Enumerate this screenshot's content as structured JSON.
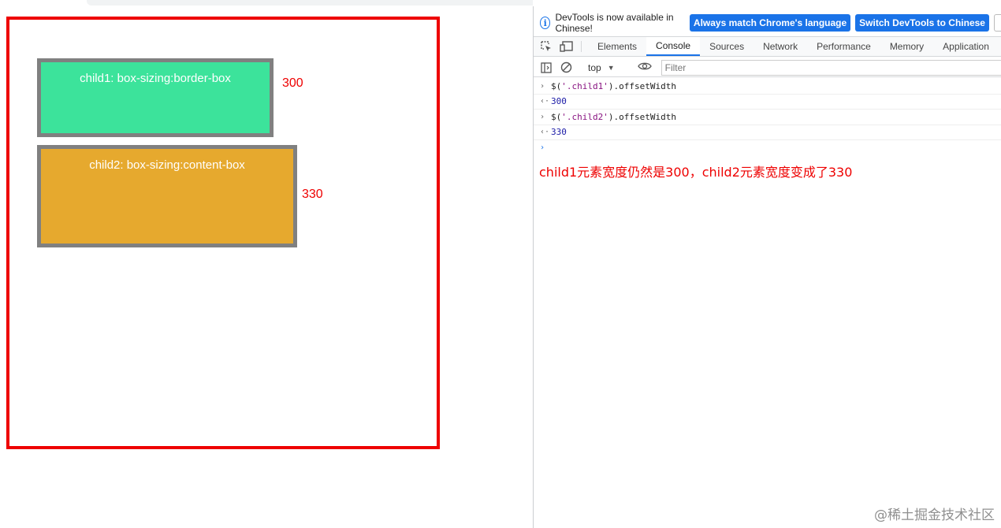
{
  "page": {
    "child1_label": "child1: box-sizing:border-box",
    "child2_label": "child2: box-sizing:content-box",
    "annotation_child1": "300",
    "annotation_child2": "330",
    "colors": {
      "parent_border": "#ee0000",
      "child1_bg": "#3ce39b",
      "child2_bg": "#e6a92e",
      "child_border": "#808080"
    }
  },
  "devtools": {
    "infobar": {
      "message": "DevTools is now available in Chinese!",
      "match_button": "Always match Chrome's language",
      "switch_button": "Switch DevTools to Chinese"
    },
    "tabs": [
      "Elements",
      "Console",
      "Sources",
      "Network",
      "Performance",
      "Memory",
      "Application"
    ],
    "active_tab": "Console",
    "console_bar": {
      "context": "top",
      "filter_placeholder": "Filter"
    },
    "console": {
      "lines": [
        {
          "type": "input",
          "prefix": "›",
          "pre": "$(",
          "str": "'.child1'",
          "post": ").offsetWidth"
        },
        {
          "type": "output",
          "prefix": "‹·",
          "value": "300"
        },
        {
          "type": "input",
          "prefix": "›",
          "pre": "$(",
          "str": "'.child2'",
          "post": ").offsetWidth"
        },
        {
          "type": "output",
          "prefix": "‹·",
          "value": "330"
        }
      ],
      "prompt": "›"
    }
  },
  "note": "child1元素宽度仍然是300，child2元素宽度变成了330",
  "watermark": "@稀土掘金技术社区"
}
